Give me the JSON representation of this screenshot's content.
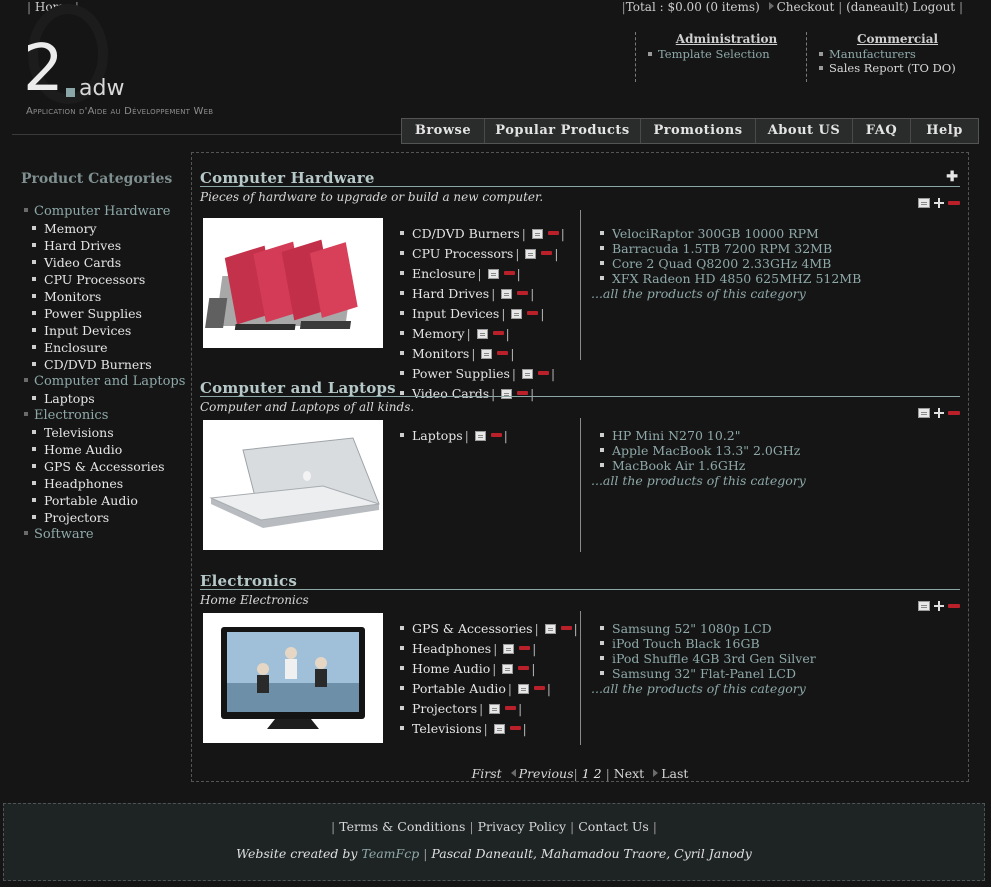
{
  "topbar": {
    "home": "Home",
    "total": "Total : $0.00 (0 items)",
    "checkout": "Checkout",
    "user": "(daneault)",
    "logout": "Logout"
  },
  "logo": {
    "number": "2",
    "name": "adw",
    "subtitle": "Application d'Aide au Développement Web"
  },
  "admin": {
    "title": "Administration",
    "items": [
      "Template Selection"
    ]
  },
  "commercial": {
    "title": "Commercial",
    "items": [
      "Manufacturers",
      "Sales Report (TO DO)"
    ]
  },
  "nav": [
    "Browse",
    "Popular Products",
    "Promotions",
    "About US",
    "FAQ",
    "Help"
  ],
  "sidebar": {
    "title": "Product Categories",
    "categories": [
      {
        "name": "Computer Hardware",
        "subs": [
          "Memory",
          "Hard Drives",
          "Video Cards",
          "CPU Processors",
          "Monitors",
          "Power Supplies",
          "Input Devices",
          "Enclosure",
          "CD/DVD Burners"
        ]
      },
      {
        "name": "Computer and Laptops",
        "subs": [
          "Laptops"
        ]
      },
      {
        "name": "Electronics",
        "subs": [
          "Televisions",
          "Home Audio",
          "GPS & Accessories",
          "Headphones",
          "Portable Audio",
          "Projectors"
        ]
      },
      {
        "name": "Software",
        "subs": []
      }
    ]
  },
  "main": {
    "add_symbol": "✚",
    "sections": [
      {
        "title": "Computer Hardware",
        "description": "Pieces of hardware to upgrade or build a new computer.",
        "image": "graphics-cards",
        "subcategories": [
          "CD/DVD Burners",
          "CPU Processors",
          "Enclosure",
          "Hard Drives",
          "Input Devices",
          "Memory",
          "Monitors",
          "Power Supplies",
          "Video Cards"
        ],
        "products": [
          "VelociRaptor 300GB 10000 RPM",
          "Barracuda 1.5TB 7200 RPM 32MB",
          "Core 2 Quad Q8200 2.33GHz 4MB",
          "XFX Radeon HD 4850 625MHZ 512MB"
        ],
        "all_link": "...all the products of this category"
      },
      {
        "title": "Computer and Laptops",
        "description": "Computer and Laptops of all kinds.",
        "image": "laptop",
        "subcategories": [
          "Laptops"
        ],
        "products": [
          "HP Mini N270 10.2\"",
          "Apple MacBook 13.3\" 2.0GHz",
          "MacBook Air 1.6GHz"
        ],
        "all_link": "...all the products of this category"
      },
      {
        "title": "Electronics",
        "description": "Home Electronics",
        "image": "television",
        "subcategories": [
          "GPS & Accessories",
          "Headphones",
          "Home Audio",
          "Portable Audio",
          "Projectors",
          "Televisions"
        ],
        "products": [
          "Samsung 52\" 1080p LCD",
          "iPod Touch Black 16GB",
          "iPod Shuffle 4GB 3rd Gen Silver",
          "Samsung 32\" Flat-Panel LCD"
        ],
        "all_link": "...all the products of this category"
      }
    ]
  },
  "pager": {
    "first": "First",
    "previous": "Previous",
    "page1": "1",
    "page2": "2",
    "next": "Next",
    "last": "Last"
  },
  "footer": {
    "terms": "Terms & Conditions",
    "privacy": "Privacy Policy",
    "contact": "Contact Us",
    "credit_prefix": "Website created by",
    "team": "TeamFcp",
    "authors": "Pascal Daneault, Mahamadou Traore, Cyril Janody"
  },
  "colors": {
    "background": "#151515",
    "link": "#8fa9a9",
    "heading": "#b6c8c8",
    "delete": "#b9202a"
  }
}
